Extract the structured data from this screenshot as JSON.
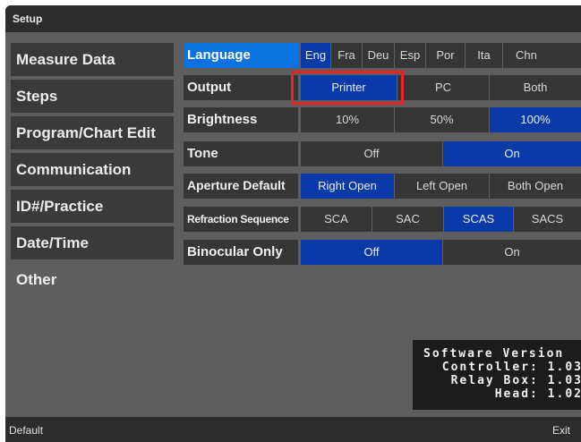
{
  "title": "Setup",
  "sidebar": {
    "items": [
      {
        "label": "Measure Data"
      },
      {
        "label": "Steps"
      },
      {
        "label": "Program/Chart Edit"
      },
      {
        "label": "Communication"
      },
      {
        "label": "ID#/Practice"
      },
      {
        "label": "Date/Time"
      },
      {
        "label": "Other"
      }
    ],
    "selected": "Other"
  },
  "settings": {
    "language": {
      "label": "Language",
      "options": [
        "Eng",
        "Fra",
        "Deu",
        "Esp",
        "Por",
        "Ita",
        "Chn"
      ],
      "selected": "Eng"
    },
    "output": {
      "label": "Output",
      "options": [
        "Printer",
        "PC",
        "Both"
      ],
      "selected": "Printer"
    },
    "brightness": {
      "label": "Brightness",
      "options": [
        "10%",
        "50%",
        "100%"
      ],
      "selected": "100%"
    },
    "tone": {
      "label": "Tone",
      "options": [
        "Off",
        "On"
      ],
      "selected": "On"
    },
    "aperture_default": {
      "label": "Aperture Default",
      "options": [
        "Right Open",
        "Left Open",
        "Both Open"
      ],
      "selected": "Right Open"
    },
    "refraction_sequence": {
      "label": "Refraction Sequence",
      "options": [
        "SCA",
        "SAC",
        "SCAS",
        "SACS"
      ],
      "selected": "SCAS"
    },
    "binocular_only": {
      "label": "Binocular Only",
      "options": [
        "Off",
        "On"
      ],
      "selected": "Off"
    }
  },
  "version_info": {
    "title": "Software Version",
    "controller": "Controller: 1.03",
    "relay_box": "Relay Box: 1.03",
    "head": "Head: 1.02"
  },
  "footer": {
    "default_label": "Default",
    "exit_label": "Exit"
  },
  "colors": {
    "selected_option": "#0a3aa8",
    "active_label": "#0a73e0",
    "highlight_box": "#e8242a",
    "panel_background": "#5e5e5e"
  }
}
